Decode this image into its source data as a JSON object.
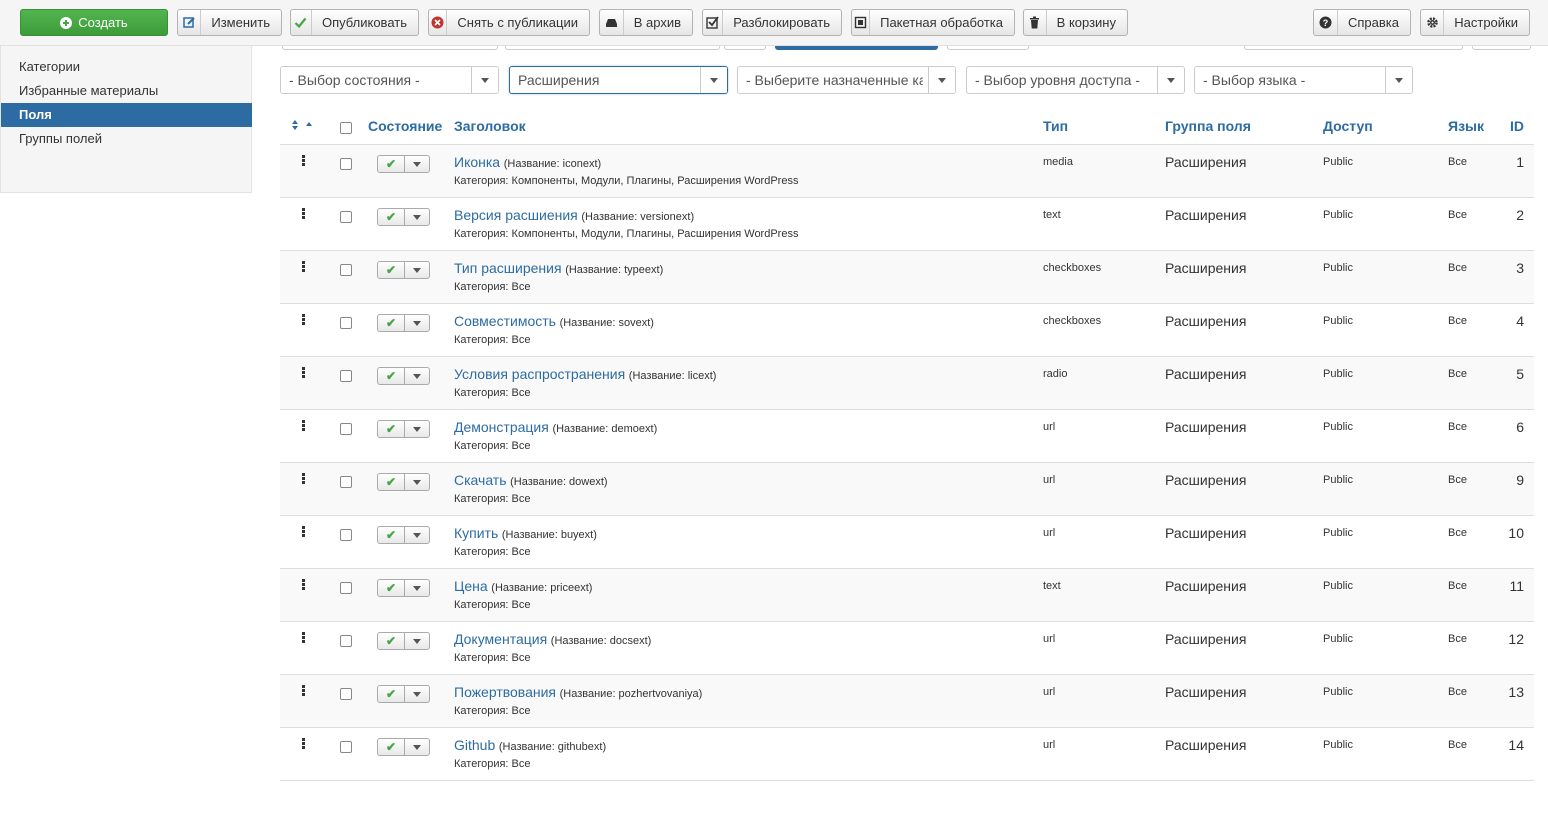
{
  "toolbar": {
    "buttons": [
      {
        "label": "Создать",
        "icon": "plus-circle-icon"
      },
      {
        "label": "Изменить",
        "icon": "edit-icon"
      },
      {
        "label": "Опубликовать",
        "icon": "check-icon"
      },
      {
        "label": "Снять с публикации",
        "icon": "times-circle-icon"
      },
      {
        "label": "В архив",
        "icon": "archive-icon"
      },
      {
        "label": "Разблокировать",
        "icon": "checkbox-icon"
      },
      {
        "label": "Пакетная обработка",
        "icon": "square-icon"
      },
      {
        "label": "В корзину",
        "icon": "trash-icon"
      },
      {
        "label": "Справка",
        "icon": "question-icon"
      },
      {
        "label": "Настройки",
        "icon": "gear-icon"
      }
    ]
  },
  "sidebar": {
    "items": [
      {
        "label": "Категории",
        "active": false
      },
      {
        "label": "Избранные материалы",
        "active": false
      },
      {
        "label": "Поля",
        "active": true
      },
      {
        "label": "Группы полей",
        "active": false
      }
    ]
  },
  "filters": {
    "state": "- Выбор состояния -",
    "context": "Расширения",
    "category": "- Выберите назначенные категории -",
    "access": "- Выбор уровня доступа -",
    "language": "- Выбор языка -"
  },
  "table": {
    "headers": {
      "state": "Состояние",
      "title": "Заголовок",
      "type": "Тип",
      "group": "Группа поля",
      "access": "Доступ",
      "language": "Язык",
      "id": "ID"
    },
    "alias_prefix": "(Название: ",
    "category_prefix": "Категория: ",
    "rows": [
      {
        "title": "Иконка",
        "alias": "(Название: iconext)",
        "category": "Категория: Компоненты, Модули, Плагины, Расширения WordPress",
        "type": "media",
        "group": "Расширения",
        "access": "Public",
        "language": "Все",
        "id": "1"
      },
      {
        "title": "Версия расшиения",
        "alias": "(Название: versionext)",
        "category": "Категория: Компоненты, Модули, Плагины, Расширения WordPress",
        "type": "text",
        "group": "Расширения",
        "access": "Public",
        "language": "Все",
        "id": "2"
      },
      {
        "title": "Тип расширения",
        "alias": "(Название: typeext)",
        "category": "Категория: Все",
        "type": "checkboxes",
        "group": "Расширения",
        "access": "Public",
        "language": "Все",
        "id": "3"
      },
      {
        "title": "Совместимость",
        "alias": "(Название: sovext)",
        "category": "Категория: Все",
        "type": "checkboxes",
        "group": "Расширения",
        "access": "Public",
        "language": "Все",
        "id": "4"
      },
      {
        "title": "Условия распространения",
        "alias": "(Название: licext)",
        "category": "Категория: Все",
        "type": "radio",
        "group": "Расширения",
        "access": "Public",
        "language": "Все",
        "id": "5"
      },
      {
        "title": "Демонстрация",
        "alias": "(Название: demoext)",
        "category": "Категория: Все",
        "type": "url",
        "group": "Расширения",
        "access": "Public",
        "language": "Все",
        "id": "6"
      },
      {
        "title": "Скачать",
        "alias": "(Название: dowext)",
        "category": "Категория: Все",
        "type": "url",
        "group": "Расширения",
        "access": "Public",
        "language": "Все",
        "id": "9"
      },
      {
        "title": "Купить",
        "alias": "(Название: buyext)",
        "category": "Категория: Все",
        "type": "url",
        "group": "Расширения",
        "access": "Public",
        "language": "Все",
        "id": "10"
      },
      {
        "title": "Цена",
        "alias": "(Название: priceext)",
        "category": "Категория: Все",
        "type": "text",
        "group": "Расширения",
        "access": "Public",
        "language": "Все",
        "id": "11"
      },
      {
        "title": "Документация",
        "alias": "(Название: docsext)",
        "category": "Категория: Все",
        "type": "url",
        "group": "Расширения",
        "access": "Public",
        "language": "Все",
        "id": "12"
      },
      {
        "title": "Пожертвования",
        "alias": "(Название: pozhertvovaniya)",
        "category": "Категория: Все",
        "type": "url",
        "group": "Расширения",
        "access": "Public",
        "language": "Все",
        "id": "13"
      },
      {
        "title": "Github",
        "alias": "(Название: githubext)",
        "category": "Категория: Все",
        "type": "url",
        "group": "Расширения",
        "access": "Public",
        "language": "Все",
        "id": "14"
      }
    ]
  },
  "colors": {
    "accent": "#2d6ca2",
    "create_button": "#46a546",
    "published_check": "#46a546"
  }
}
